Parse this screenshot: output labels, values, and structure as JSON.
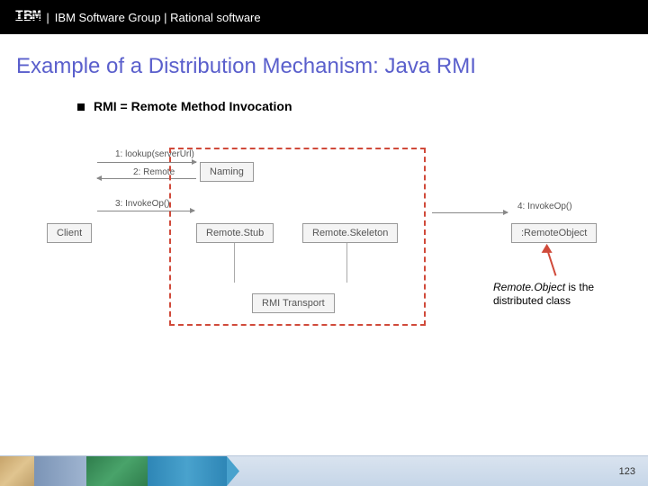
{
  "header": {
    "logo": "IBM",
    "text": "IBM Software Group | Rational software"
  },
  "title": "Example of a Distribution Mechanism: Java RMI",
  "bullet": "RMI = Remote Method Invocation",
  "diagram": {
    "messages": {
      "m1": "1: lookup(serverUrl)",
      "m2": "2: Remote",
      "m3": "3: InvokeOp()",
      "m4": "4: InvokeOp()"
    },
    "boxes": {
      "naming": "Naming",
      "client": "Client",
      "remoteStub": "Remote.Stub",
      "remoteSkeleton": "Remote.Skeleton",
      "remoteObject": ":RemoteObject",
      "rmiTransport": "RMI Transport"
    }
  },
  "annotation": {
    "line1": "Remote.Object",
    "line2": " is the distributed class"
  },
  "page": "123"
}
